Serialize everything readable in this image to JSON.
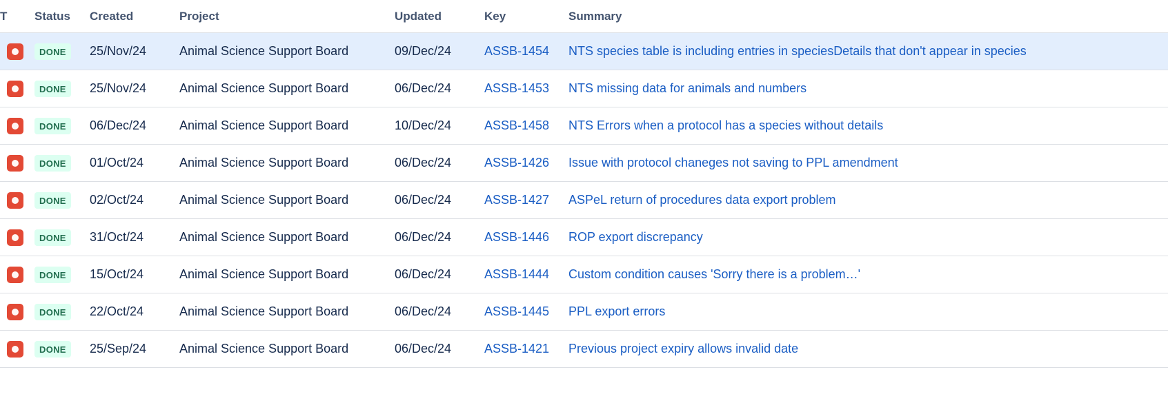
{
  "table": {
    "columns": [
      {
        "key": "type",
        "label": "T"
      },
      {
        "key": "status",
        "label": "Status"
      },
      {
        "key": "created",
        "label": "Created"
      },
      {
        "key": "project",
        "label": "Project"
      },
      {
        "key": "updated",
        "label": "Updated"
      },
      {
        "key": "key",
        "label": "Key"
      },
      {
        "key": "summary",
        "label": "Summary"
      }
    ],
    "rows": [
      {
        "type_icon": "bug-icon",
        "status": "DONE",
        "created": "25/Nov/24",
        "project": "Animal Science Support Board",
        "updated": "09/Dec/24",
        "key": "ASSB-1454",
        "summary": "NTS species table is including entries in speciesDetails that don't appear in species",
        "selected": true
      },
      {
        "type_icon": "bug-icon",
        "status": "DONE",
        "created": "25/Nov/24",
        "project": "Animal Science Support Board",
        "updated": "06/Dec/24",
        "key": "ASSB-1453",
        "summary": "NTS missing data for animals and numbers",
        "selected": false
      },
      {
        "type_icon": "bug-icon",
        "status": "DONE",
        "created": "06/Dec/24",
        "project": "Animal Science Support Board",
        "updated": "10/Dec/24",
        "key": "ASSB-1458",
        "summary": "NTS Errors when a protocol has a species without details",
        "selected": false
      },
      {
        "type_icon": "bug-icon",
        "status": "DONE",
        "created": "01/Oct/24",
        "project": "Animal Science Support Board",
        "updated": "06/Dec/24",
        "key": "ASSB-1426",
        "summary": "Issue with protocol chaneges not saving to PPL amendment",
        "selected": false
      },
      {
        "type_icon": "bug-icon",
        "status": "DONE",
        "created": "02/Oct/24",
        "project": "Animal Science Support Board",
        "updated": "06/Dec/24",
        "key": "ASSB-1427",
        "summary": "ASPeL return of procedures data export problem",
        "selected": false
      },
      {
        "type_icon": "bug-icon",
        "status": "DONE",
        "created": "31/Oct/24",
        "project": "Animal Science Support Board",
        "updated": "06/Dec/24",
        "key": "ASSB-1446",
        "summary": "ROP export discrepancy",
        "selected": false
      },
      {
        "type_icon": "bug-icon",
        "status": "DONE",
        "created": "15/Oct/24",
        "project": "Animal Science Support Board",
        "updated": "06/Dec/24",
        "key": "ASSB-1444",
        "summary": "Custom condition causes 'Sorry there is a problem…'",
        "selected": false
      },
      {
        "type_icon": "bug-icon",
        "status": "DONE",
        "created": "22/Oct/24",
        "project": "Animal Science Support Board",
        "updated": "06/Dec/24",
        "key": "ASSB-1445",
        "summary": "PPL export errors",
        "selected": false
      },
      {
        "type_icon": "bug-icon",
        "status": "DONE",
        "created": "25/Sep/24",
        "project": "Animal Science Support Board",
        "updated": "06/Dec/24",
        "key": "ASSB-1421",
        "summary": "Previous project expiry allows invalid date",
        "selected": false
      }
    ]
  },
  "colors": {
    "link": "#1B5EC4",
    "header_text": "#44546F",
    "row_text": "#172B4D",
    "selected_row_bg": "#E3EEFD",
    "row_border": "#DCDFE4",
    "bug_icon_bg": "#E34935",
    "status_done_bg": "#DCFFF1",
    "status_done_text": "#216E4E"
  }
}
